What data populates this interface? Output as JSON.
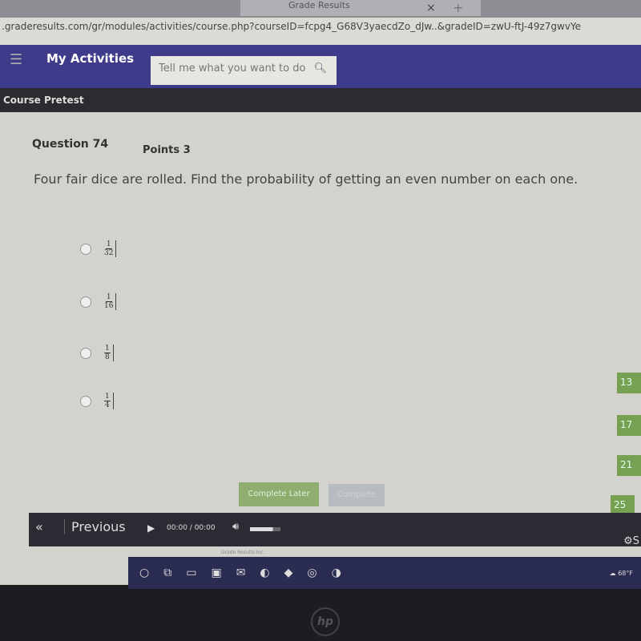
{
  "browser": {
    "tab_title": "Grade Results",
    "url": ".graderesults.com/gr/modules/activities/course.php?courseID=fcpg4_G68V3yaecdZo_dJw..&gradeID=zwU-ftJ-49z7gwvYe"
  },
  "nav": {
    "brand": "My Activities",
    "search_placeholder": "Tell me what you want to do"
  },
  "strip": {
    "title": "Course Pretest"
  },
  "question": {
    "number_label": "Question 74",
    "points_label": "Points 3",
    "text": "Four fair dice are rolled. Find the probability of getting an even number on each one.",
    "options": [
      {
        "num": "1",
        "den": "32"
      },
      {
        "num": "1",
        "den": "16"
      },
      {
        "num": "1",
        "den": "8"
      },
      {
        "num": "1",
        "den": "4"
      }
    ]
  },
  "side_numbers": [
    "13",
    "17",
    "21",
    "25"
  ],
  "buttons": {
    "complete_later": "Complete Later",
    "complete": "Complete"
  },
  "player": {
    "previous": "Previous",
    "time": "00:00 / 00:00",
    "volume_level": 0.75,
    "settings": "S"
  },
  "footer": "Grade Results Inc.",
  "taskbar": {
    "weather": "68°F"
  },
  "colors": {
    "nav": "#3e3c8a",
    "green": "#77a052"
  }
}
